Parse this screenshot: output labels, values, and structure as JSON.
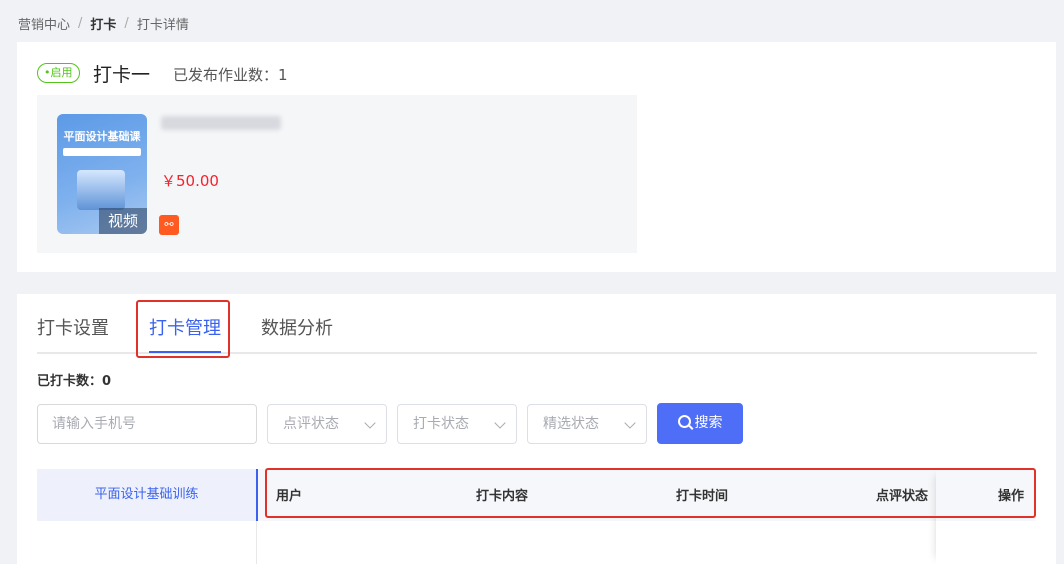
{
  "breadcrumb": {
    "items": [
      "营销中心",
      "打卡",
      "打卡详情"
    ],
    "separator": "/"
  },
  "header": {
    "status_badge": "•启用",
    "title": "打卡一",
    "published_label": "已发布作业数：1"
  },
  "product": {
    "cover_title": "平面设计基础课",
    "cover_tag": "视频",
    "price": "￥50.00",
    "icon": "product-type-icon"
  },
  "tabs": [
    {
      "label": "打卡设置",
      "active": false
    },
    {
      "label": "打卡管理",
      "active": true
    },
    {
      "label": "数据分析",
      "active": false
    }
  ],
  "stats": {
    "checked_in_count": "已打卡数：0"
  },
  "filters": {
    "phone_placeholder": "请输入手机号",
    "review_status": "点评状态",
    "checkin_status": "打卡状态",
    "featured_status": "精选状态",
    "search_label": "搜索"
  },
  "sidebar": {
    "items": [
      "平面设计基础训练"
    ]
  },
  "table": {
    "columns": [
      "用户",
      "打卡内容",
      "打卡时间",
      "点评状态",
      "操作"
    ]
  },
  "colors": {
    "accent": "#3b62ee",
    "button": "#4f6ef7",
    "price": "#f5222d",
    "status_green": "#52c41a",
    "highlight_red": "#e0322b"
  }
}
